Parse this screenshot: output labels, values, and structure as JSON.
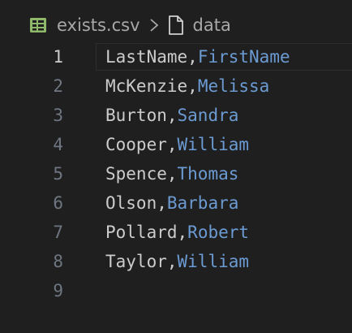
{
  "breadcrumb": {
    "file_name": "exists.csv",
    "separator": ">",
    "symbol": "data",
    "file_icon": "csv-table-icon",
    "symbol_icon": "file-icon"
  },
  "editor": {
    "current_line": 1,
    "lines": [
      {
        "number": "1",
        "col1": "LastName",
        "sep": ",",
        "col2": "FirstName"
      },
      {
        "number": "2",
        "col1": "McKenzie",
        "sep": ",",
        "col2": "Melissa"
      },
      {
        "number": "3",
        "col1": "Burton",
        "sep": ",",
        "col2": "Sandra"
      },
      {
        "number": "4",
        "col1": "Cooper",
        "sep": ",",
        "col2": "William"
      },
      {
        "number": "5",
        "col1": "Spence",
        "sep": ",",
        "col2": "Thomas"
      },
      {
        "number": "6",
        "col1": "Olson",
        "sep": ",",
        "col2": "Barbara"
      },
      {
        "number": "7",
        "col1": "Pollard",
        "sep": ",",
        "col2": "Robert"
      },
      {
        "number": "8",
        "col1": "Taylor",
        "sep": ",",
        "col2": "William"
      },
      {
        "number": "9",
        "col1": "",
        "sep": "",
        "col2": ""
      }
    ]
  },
  "colors": {
    "background": "#1f1f1f",
    "column1": "#cccccc",
    "column2": "#6b9bd2",
    "line_number": "#6e7681",
    "csv_icon": "#8fb86b"
  }
}
